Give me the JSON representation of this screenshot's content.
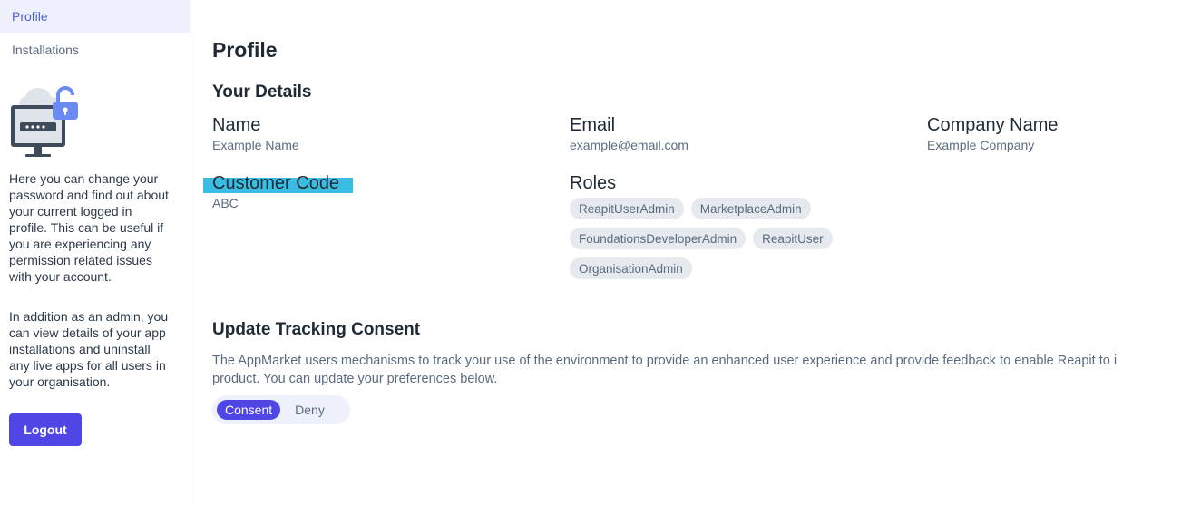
{
  "sidebar": {
    "items": [
      {
        "label": "Profile",
        "active": true
      },
      {
        "label": "Installations",
        "active": false
      }
    ],
    "illustration_icon": "monitor-lock-icon",
    "help_text_1": "Here you can change your password and find out about your current logged in profile. This can be useful if you are experiencing any permission related issues with your account.",
    "help_text_2": "In addition as an admin, you can view details of your app installations and uninstall any live apps for all users in your organisation.",
    "logout_label": "Logout"
  },
  "main": {
    "title": "Profile",
    "details": {
      "heading": "Your Details",
      "name_label": "Name",
      "name_value": "Example Name",
      "email_label": "Email",
      "email_value": "example@email.com",
      "company_label": "Company Name",
      "company_value": "Example Company",
      "customer_code_label": "Customer Code",
      "customer_code_value": "ABC",
      "roles_label": "Roles",
      "roles": [
        "ReapitUserAdmin",
        "MarketplaceAdmin",
        "FoundationsDeveloperAdmin",
        "ReapitUser",
        "OrganisationAdmin"
      ]
    },
    "consent": {
      "heading": "Update Tracking Consent",
      "text_line1": "The AppMarket users mechanisms to track your use of the environment to provide an enhanced user experience and provide feedback to enable Reapit to i",
      "text_line2": "product. You can update your preferences below.",
      "consent_label": "Consent",
      "deny_label": "Deny",
      "selected": "Consent"
    }
  },
  "colors": {
    "accent": "#4f46e5",
    "highlight": "#39bde3",
    "active_nav_bg": "#eef1fd"
  }
}
